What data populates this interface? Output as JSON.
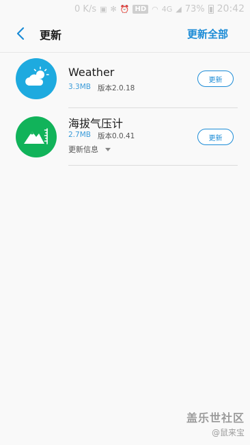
{
  "status_bar": {
    "speed": "0 K/s",
    "hd": "HD",
    "network": "4G",
    "battery": "73%",
    "time": "20:42"
  },
  "header": {
    "title": "更新",
    "update_all": "更新全部"
  },
  "apps": [
    {
      "name": "Weather",
      "size": "3.3MB",
      "version": "版本2.0.18",
      "button": "更新",
      "icon": "weather-icon",
      "color": "#1eaadf"
    },
    {
      "name": "海拔气压计",
      "size": "2.7MB",
      "version": "版本0.0.41",
      "button": "更新",
      "info": "更新信息",
      "icon": "mountain-icon",
      "color": "#11b35a"
    }
  ],
  "watermark": {
    "line1": "盖乐世社区",
    "line2": "@鼠来宝"
  },
  "colors": {
    "accent": "#1b8bd6",
    "background": "#f9f9f9"
  }
}
